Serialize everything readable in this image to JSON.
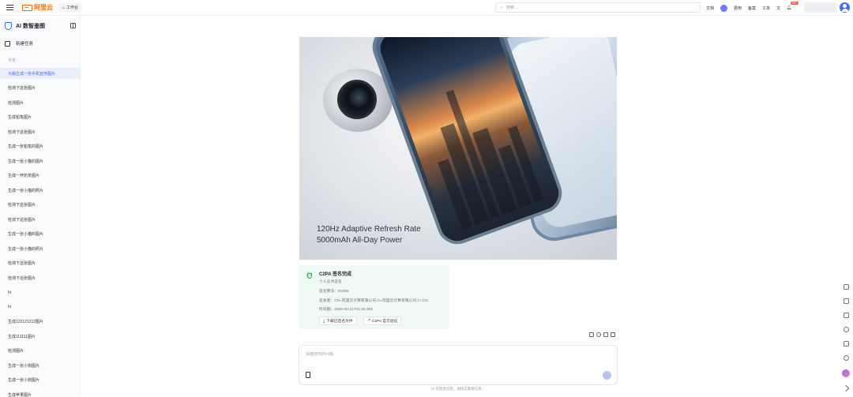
{
  "topbar": {
    "logo_text": "阿里云",
    "workbench": "工作台",
    "search_placeholder": "搜索...",
    "links": [
      "文档",
      "费用",
      "备案",
      "工单"
    ],
    "bell_badge": "99+"
  },
  "sidebar": {
    "title": "AI 数智鉴图",
    "new_task": "新建任务",
    "section_label": "今天",
    "items": [
      {
        "label": "为我生成一张手机宣传图片",
        "active": true
      },
      {
        "label": "检测下这张图片"
      },
      {
        "label": "检测图片"
      },
      {
        "label": "生成铅笔图片"
      },
      {
        "label": "检测下这张图片"
      },
      {
        "label": "生成一张铅笔的图片"
      },
      {
        "label": "生成一张小猫的图片"
      },
      {
        "label": "生成一杯奶茶图片"
      },
      {
        "label": "生成一张小猫的照片"
      },
      {
        "label": "检测下这张图片"
      },
      {
        "label": "检测下这张图片"
      },
      {
        "label": "生成一张小猫的图片"
      },
      {
        "label": "生成一张小猫的照片"
      },
      {
        "label": "检测下这张图片"
      },
      {
        "label": "检测下这张图片"
      },
      {
        "label": "hi"
      },
      {
        "label": "hi"
      },
      {
        "label": "生成122121212图片"
      },
      {
        "label": "生成111111图片"
      },
      {
        "label": "检测图片"
      },
      {
        "label": "生成一张小狗图片"
      },
      {
        "label": "生成一张小狗图片"
      },
      {
        "label": "生成苹果图片"
      }
    ]
  },
  "main": {
    "image_text_line1": "120Hz Adaptive Refresh Rate",
    "image_text_line2": "5000mAh All-Day Power",
    "c2pa": {
      "title": "C2PA 签名完成",
      "subtitle": "个人证书签名",
      "algorithm": "签名算法：Es256",
      "issuer": "签发者：CN=阿里云计算有限公司,O=阿里云计算有限公司,C=CN",
      "time": "时间戳：2026-05-21T01:55:35Z",
      "download_button": "下载已签名文件",
      "verify_button": "C2PA 官方验证"
    },
    "chat_placeholder": "请描述你的问题",
    "disclaimer": "AI 可能会出错，请核实重要信息。"
  },
  "colors": {
    "accent": "#3a6bf0",
    "brand": "#ff6a00",
    "success": "#2aa45b"
  }
}
